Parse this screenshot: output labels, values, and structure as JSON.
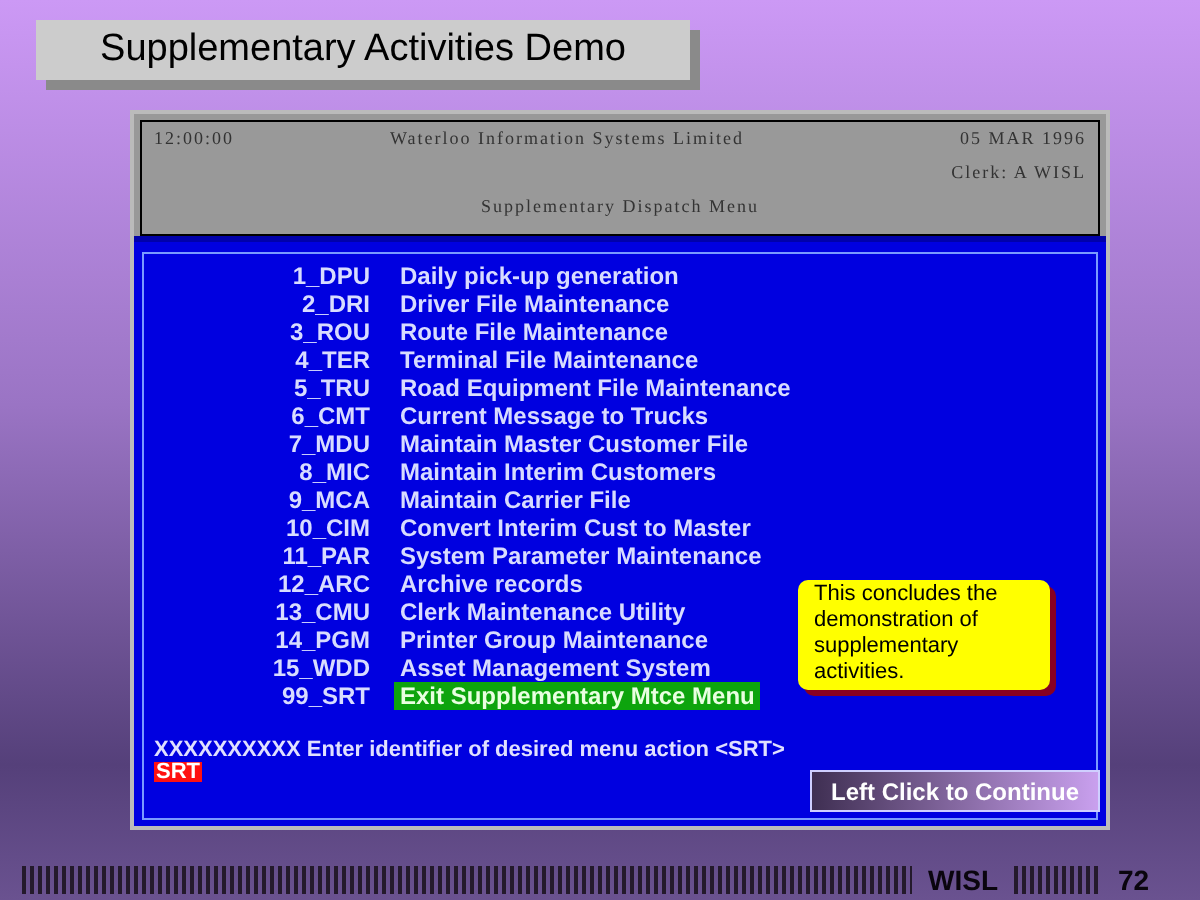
{
  "slide_title": "Supplementary Activities Demo",
  "terminal": {
    "header": {
      "time": "12:00:00",
      "company": "Waterloo Information Systems Limited",
      "date": "05 MAR 1996",
      "clerk": "Clerk:  A WISL",
      "menu_title": "Supplementary Dispatch Menu"
    },
    "menu_items": [
      {
        "code": "1_DPU",
        "label": "Daily pick-up generation",
        "selected": false
      },
      {
        "code": "2_DRI",
        "label": "Driver File Maintenance",
        "selected": false
      },
      {
        "code": "3_ROU",
        "label": "Route File Maintenance",
        "selected": false
      },
      {
        "code": "4_TER",
        "label": "Terminal File Maintenance",
        "selected": false
      },
      {
        "code": "5_TRU",
        "label": "Road Equipment File Maintenance",
        "selected": false
      },
      {
        "code": "6_CMT",
        "label": "Current Message to Trucks",
        "selected": false
      },
      {
        "code": "7_MDU",
        "label": "Maintain Master Customer File",
        "selected": false
      },
      {
        "code": "8_MIC",
        "label": "Maintain Interim Customers",
        "selected": false
      },
      {
        "code": "9_MCA",
        "label": "Maintain Carrier File",
        "selected": false
      },
      {
        "code": "10_CIM",
        "label": "Convert Interim Cust to Master",
        "selected": false
      },
      {
        "code": "11_PAR",
        "label": "System Parameter Maintenance",
        "selected": false
      },
      {
        "code": "12_ARC",
        "label": "Archive records",
        "selected": false
      },
      {
        "code": "13_CMU",
        "label": "Clerk Maintenance Utility",
        "selected": false
      },
      {
        "code": "14_PGM",
        "label": "Printer Group Maintenance",
        "selected": false
      },
      {
        "code": "15_WDD",
        "label": "Asset Management System",
        "selected": false
      },
      {
        "code": "99_SRT",
        "label": "Exit Supplementary Mtce Menu",
        "selected": true
      }
    ],
    "prompt": "XXXXXXXXXX Enter identifier of desired menu action <SRT>",
    "input_value": "SRT"
  },
  "callout": "This concludes the demonstration of supplementary activities.",
  "continue_button": "Left Click to Continue",
  "footer": {
    "brand": "WISL",
    "page": "72"
  }
}
